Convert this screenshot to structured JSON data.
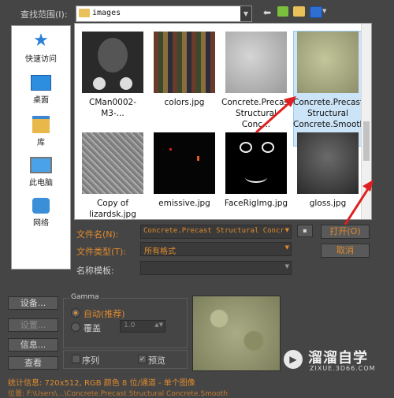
{
  "top": {
    "lookin_label": "查找范围(I):",
    "folder": "images"
  },
  "places": [
    "快速访问",
    "桌面",
    "库",
    "此电脑",
    "网络"
  ],
  "files": [
    {
      "name": "CMan0002-M3-..."
    },
    {
      "name": "colors.jpg"
    },
    {
      "name": "Concrete.Precast Structural Conc..."
    },
    {
      "name": "Concrete.Precast Structural Concrete.Smooth",
      "selected": true
    },
    {
      "name": "Copy of lizardsk.jpg"
    },
    {
      "name": "emissive.jpg"
    },
    {
      "name": "FaceRigImg.jpg"
    },
    {
      "name": "gloss.jpg"
    }
  ],
  "form": {
    "filename_label": "文件名(N):",
    "filename_value": "Concrete.Precast Structural Concr",
    "filetype_label": "文件类型(T):",
    "filetype_value": "所有格式",
    "template_label": "名称模板:",
    "template_value": "",
    "open_button": "打开(O)",
    "cancel_button": "取消"
  },
  "left_buttons": [
    "设备...",
    "设置...",
    "信息...",
    "查看"
  ],
  "gamma": {
    "title": "Gamma",
    "auto": "自动(推荐)",
    "override": "覆盖",
    "value": "1.0"
  },
  "checks": {
    "sequence": "序列",
    "preview": "预览"
  },
  "stats": "统计信息:  720x512, RGB 颜色 8 位/通道 - 单个图像",
  "path": "位置:  F:\\Users\\...\\Concrete.Precast Structural Concrete.Smooth",
  "watermark": {
    "name": "溜溜自学",
    "url": "ZIXUE.3D66.COM"
  }
}
